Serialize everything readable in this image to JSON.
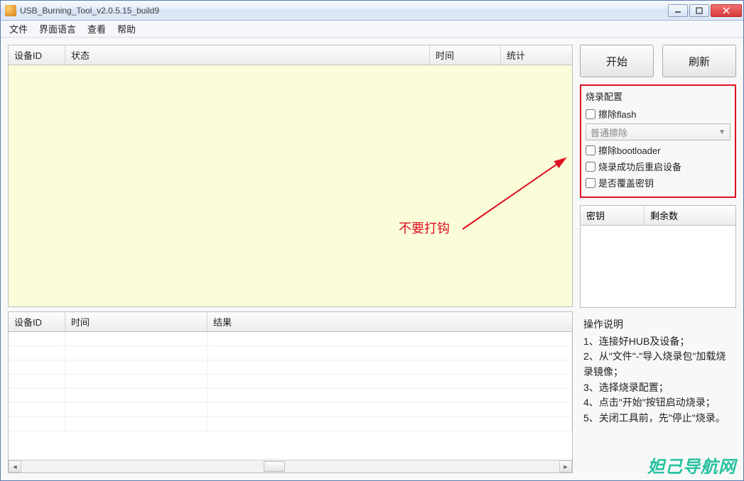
{
  "titlebar": {
    "title": "USB_Burning_Tool_v2.0.5.15_build9"
  },
  "menu": {
    "file": "文件",
    "lang": "界面语言",
    "view": "查看",
    "help": "帮助"
  },
  "grid1": {
    "col1": "设备ID",
    "col2": "状态",
    "col3": "时间",
    "col4": "统计"
  },
  "grid2": {
    "col1": "设备ID",
    "col2": "时间",
    "col3": "结果"
  },
  "buttons": {
    "start": "开始",
    "refresh": "刷新"
  },
  "config": {
    "legend": "烧录配置",
    "erase_flash": "擦除flash",
    "erase_mode": "普通擦除",
    "erase_bootloader": "擦除bootloader",
    "reboot": "烧录成功后重启设备",
    "override_key": "是否覆盖密钥"
  },
  "keygrid": {
    "col1": "密钥",
    "col2": "剩余数"
  },
  "instructions": {
    "title": "操作说明",
    "l1": "1、连接好HUB及设备；",
    "l2": "2、从\"文件\"-\"导入烧录包\"加载烧录镜像；",
    "l3": "3、选择烧录配置；",
    "l4": "4、点击\"开始\"按钮启动烧录；",
    "l5": "5、关闭工具前，先\"停止\"烧录。"
  },
  "annotation": {
    "text": "不要打钩"
  },
  "watermark": {
    "text": "妲己导航网"
  }
}
